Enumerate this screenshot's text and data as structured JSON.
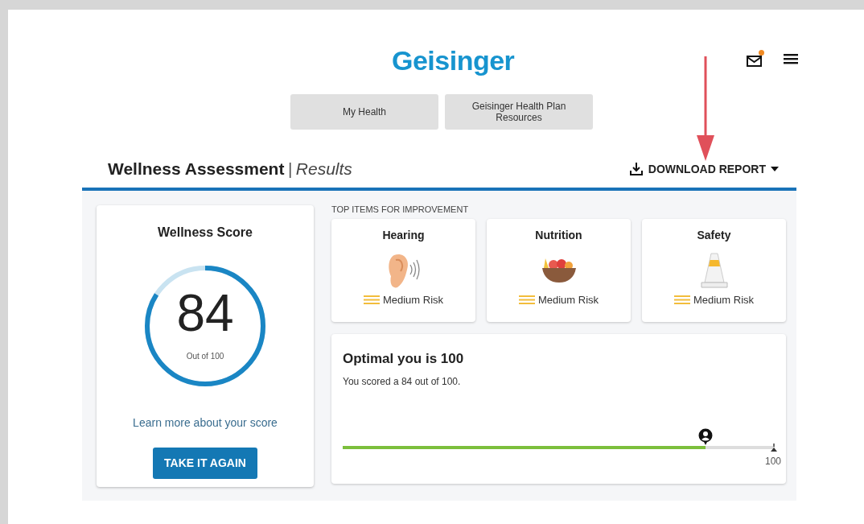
{
  "header": {
    "logo": "Geisinger",
    "mail": {
      "unread": true
    }
  },
  "tabs": [
    {
      "label": "My Health"
    },
    {
      "label": "Geisinger Health Plan Resources"
    }
  ],
  "page_title": {
    "main": "Wellness Assessment",
    "separator": "|",
    "sub": "Results"
  },
  "download": {
    "label": "DOWNLOAD REPORT"
  },
  "annotation": {
    "kind": "arrow"
  },
  "score_card": {
    "title": "Wellness Score",
    "score": "84",
    "caption": "Out of 100",
    "level": 0.84,
    "link": "Learn more about your score",
    "button": "TAKE IT AGAIN"
  },
  "improvement": {
    "heading": "TOP ITEMS FOR IMPROVEMENT",
    "items": [
      {
        "title": "Hearing",
        "kind": "ear",
        "risk": "Medium Risk"
      },
      {
        "title": "Nutrition",
        "kind": "fruit-bowl",
        "risk": "Medium Risk"
      },
      {
        "title": "Safety",
        "kind": "cone",
        "risk": "Medium Risk"
      }
    ]
  },
  "optimal": {
    "title": "Optimal you is 100",
    "text": "You scored a 84 out of 100.",
    "level": 0.84,
    "max_label": "100"
  }
}
